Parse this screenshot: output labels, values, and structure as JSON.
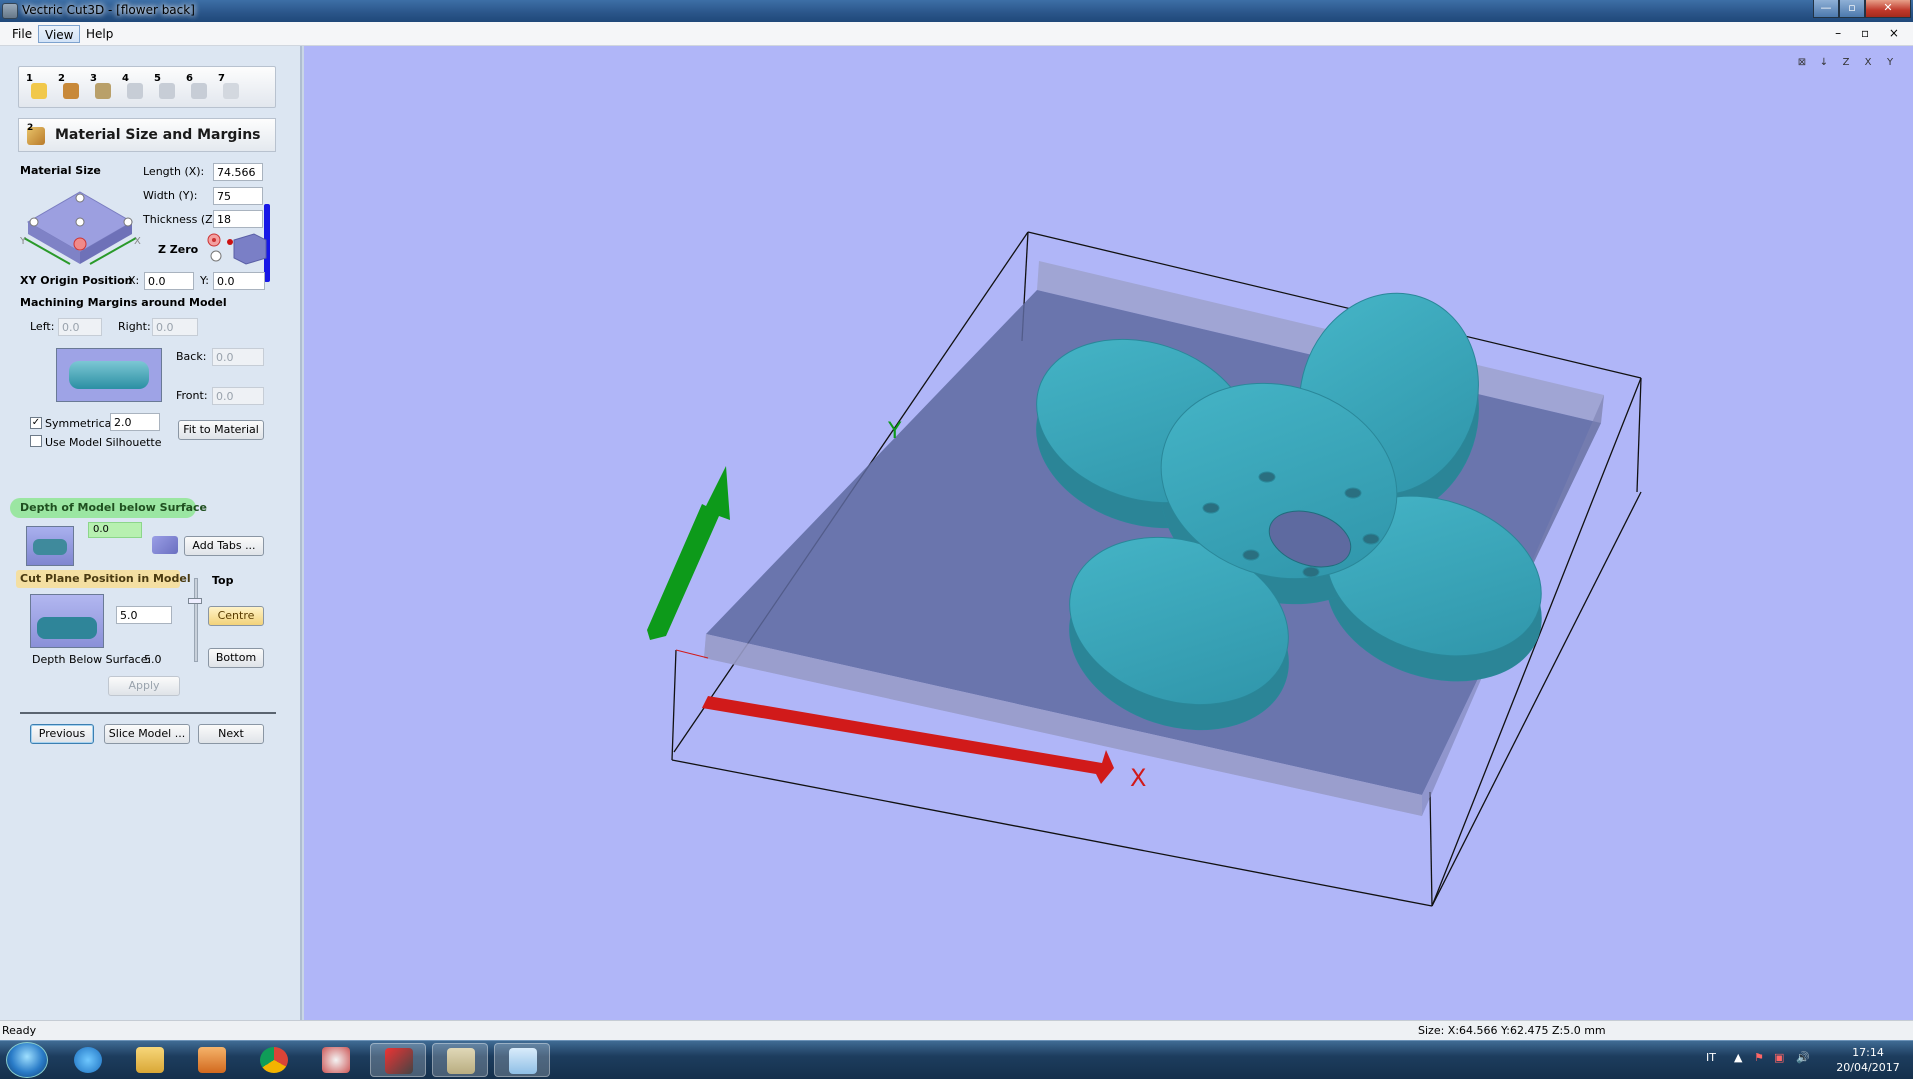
{
  "window": {
    "title": "Vectric Cut3D - [flower back]",
    "minimize": "—",
    "maximize": "▫",
    "close": "✕"
  },
  "menu": {
    "items": [
      "File",
      "View",
      "Help"
    ],
    "active": "View",
    "mdi_controls": "– ▫ ×"
  },
  "toolbar": {
    "steps": [
      {
        "num": "1",
        "icon": "open-folder-icon"
      },
      {
        "num": "2",
        "icon": "material-block-icon"
      },
      {
        "num": "3",
        "icon": "orientation-icon"
      },
      {
        "num": "4",
        "icon": "roughing-icon"
      },
      {
        "num": "5",
        "icon": "finishing-icon"
      },
      {
        "num": "6",
        "icon": "preview-icon"
      },
      {
        "num": "7",
        "icon": "save-toolpath-icon"
      }
    ]
  },
  "panel": {
    "step_num": "2",
    "title": "Material Size and Margins",
    "material_size_label": "Material Size",
    "length_label": "Length (X):",
    "length_value": "74.566",
    "width_label": "Width (Y):",
    "width_value": "75",
    "thickness_label": "Thickness (Z):",
    "thickness_value": "18",
    "z_zero_label": "Z Zero",
    "xy_origin_label": "XY Origin Position",
    "x_label": "X:",
    "x_value": "0.0",
    "y_label": "Y:",
    "y_value": "0.0",
    "margins_label": "Machining Margins around Model",
    "left_label": "Left:",
    "left_value": "0.0",
    "right_label": "Right:",
    "right_value": "0.0",
    "back_label": "Back:",
    "back_value": "0.0",
    "front_label": "Front:",
    "front_value": "0.0",
    "symmetrical_label": "Symmetrical",
    "symmetrical_value": "2.0",
    "fit_button": "Fit to Material",
    "silhouette_label": "Use Model Silhouette",
    "depth_label": "Depth of Model below Surface",
    "depth_value": "0.0",
    "add_tabs_button": "Add Tabs ...",
    "cut_plane_label": "Cut Plane Position in Model",
    "top_label": "Top",
    "cut_plane_value": "5.0",
    "centre_button": "Centre",
    "bottom_button": "Bottom",
    "depth_below_label": "Depth Below Surface:",
    "depth_below_value": "5.0",
    "apply_button": "Apply",
    "previous_button": "Previous",
    "slice_button": "Slice Model ...",
    "next_button": "Next"
  },
  "viewport": {
    "axis_x": "X",
    "axis_y": "Y",
    "view_icons": [
      "zoom-all-icon",
      "iso-view-icon",
      "top-view-icon",
      "front-view-icon",
      "side-view-icon"
    ],
    "view_icon_labels": [
      "⊠",
      "↓",
      "Z",
      "X",
      "Y"
    ],
    "colors": {
      "background": "#b0b6f8",
      "model": "#3aa4b8",
      "x_axis": "#d11a1a",
      "y_axis": "#0d9a1a"
    }
  },
  "status": {
    "ready": "Ready",
    "size": "Size: X:64.566 Y:62.475 Z:5.0 mm"
  },
  "taskbar": {
    "language": "IT",
    "time": "17:14",
    "date": "20/04/2017",
    "apps": [
      "ie-icon",
      "explorer-icon",
      "media-player-icon",
      "chrome-icon",
      "paint-icon",
      "vcarve-icon",
      "cut3d-icon",
      "notepad-icon"
    ]
  }
}
